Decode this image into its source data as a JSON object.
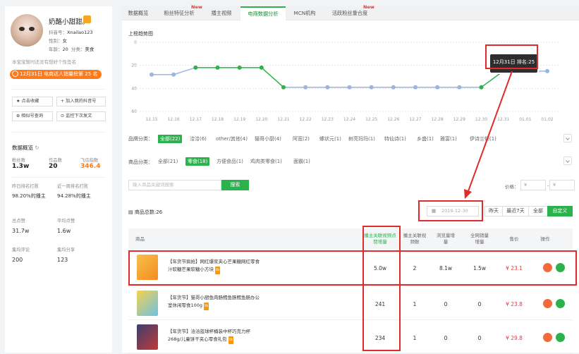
{
  "profile": {
    "name": "奶酪小甜甜。",
    "douyin_id_label": "抖音号：",
    "douyin_id": "Xnailao123",
    "gender_label": "性别：",
    "gender": "女",
    "age_label": "年龄：",
    "age": "20",
    "category_label": "分类：",
    "category": "美食",
    "signature": "本宝宝暂时还没有想好个性签名",
    "rank_badge": "12月31日 电商达人销量榜第 25 名"
  },
  "left_buttons": {
    "favorite": "点击收藏",
    "add_mine": "加入我的抖音号",
    "similar": "相似号查询",
    "monitor": "监控下次发文"
  },
  "overview": {
    "title": "数据概览",
    "stats": [
      {
        "label": "粉丝数",
        "value": "1.3w"
      },
      {
        "label": "作品数",
        "value": "20"
      },
      {
        "label": "飞瓜指数",
        "value": "346.4"
      }
    ],
    "rows": [
      {
        "label": "昨日排名打败",
        "value": "98.20%的播主"
      },
      {
        "label": "近一周排名打败",
        "value": "94.28%的播主"
      },
      {
        "label": "总点赞",
        "value": "31.7w"
      },
      {
        "label": "平均点赞",
        "value": "1.6w"
      },
      {
        "label": "集均评论",
        "value": "200"
      },
      {
        "label": "集均分享",
        "value": "123"
      }
    ]
  },
  "tabs": [
    {
      "label": "数据概览",
      "new": false
    },
    {
      "label": "粉丝特征分析",
      "new": true
    },
    {
      "label": "播主视频",
      "new": false
    },
    {
      "label": "电商数据分析",
      "new": false,
      "active": true
    },
    {
      "label": "MCN机构",
      "new": false
    },
    {
      "label": "活跃粉丝重合度",
      "new": true
    }
  ],
  "new_label": "New",
  "chart_data": {
    "type": "line",
    "title": "上榜趋势图",
    "x": [
      "12.15",
      "12.16",
      "12.17",
      "12.18",
      "12.19",
      "12.20",
      "12.21",
      "12.22",
      "12.23",
      "12.24",
      "12.25",
      "12.26",
      "12.27",
      "12.28",
      "12.29",
      "12.30",
      "12.31",
      "01.01",
      "01.02"
    ],
    "values": [
      28,
      28,
      22,
      22,
      22,
      22,
      39,
      39,
      39,
      39,
      39,
      39,
      39,
      39,
      39,
      39,
      25,
      25,
      25
    ],
    "highlight": [
      false,
      false,
      true,
      true,
      true,
      true,
      true,
      false,
      false,
      false,
      false,
      false,
      false,
      false,
      false,
      true,
      true,
      false,
      false
    ],
    "ylim": [
      60,
      0
    ],
    "yticks": [
      "0",
      "20",
      "40",
      "60"
    ],
    "tooltip": "12月31日 排名:25",
    "colors": {
      "line": "#9bb4e6",
      "highlight": "#2bb24c"
    }
  },
  "filters": {
    "brand_label": "品牌分类：",
    "brand_options": [
      "全部(22)",
      "洽洽(6)",
      "other/其他(4)",
      "猫哥小厨(4)",
      "阿宽(2)",
      "螺状元(1)",
      "树亮玛玛(1)",
      "特仙诗(1)",
      "乡盛(1)",
      "雅富(1)",
      "伊诗兰顿(1)"
    ],
    "product_label": "商品分类：",
    "product_options": [
      "全部(21)",
      "零食(18)",
      "方便食品(1)",
      "鸡肉类零食(1)",
      "面霸(1)"
    ]
  },
  "search": {
    "placeholder": "输入商品关键词搜索",
    "button": "搜索"
  },
  "price": {
    "label": "价格：",
    "min": "¥",
    "max": "¥",
    "dash": "-"
  },
  "total": "商品总数:26",
  "date": {
    "value": "2019-12-30",
    "buttons": [
      "昨天",
      "最近7天",
      "全部",
      "自定义"
    ]
  },
  "table": {
    "headers": [
      "商品",
      "播主关联视频点赞增量",
      "播主关联视频数",
      "浏览量增量",
      "全网销量增量",
      "售价",
      "操作"
    ],
    "rows": [
      {
        "name": "【年货节疯抢】网红爆浆夹心芒果糖网红零食汁软糖芒果软糖小方块",
        "likes": "5.0w",
        "videos": "2",
        "views": "8.1w",
        "sales": "1.5w",
        "price": "¥ 23.1"
      },
      {
        "name": "【年货节】猫哥小厨鱼肉肠鳕鱼肠鳕鱼肠办公室休闲零食100g",
        "likes": "241",
        "videos": "1",
        "views": "0",
        "sales": "0",
        "price": "¥ 23.8"
      },
      {
        "name": "【年货节】洽洽蓝球杯桶装中杯巧克力杯268g/儿童饼干夹心零食礼包",
        "likes": "234",
        "videos": "1",
        "views": "0",
        "sales": "0",
        "price": "¥ 29.8"
      }
    ]
  }
}
